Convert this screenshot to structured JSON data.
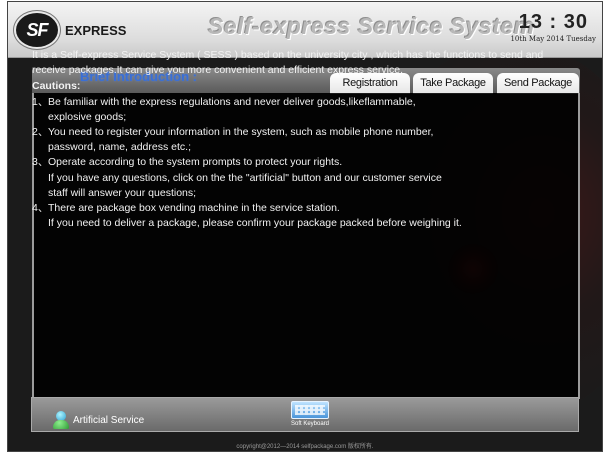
{
  "header": {
    "logo_badge": "SF",
    "logo_text": "EXPRESS",
    "system_title": "Self-express Service System",
    "time": "13 : 30",
    "date": "10th May 2014  Tuesday"
  },
  "brief": {
    "title": "Brief Introduction :"
  },
  "tabs": [
    {
      "label": "Registration"
    },
    {
      "label": "Take Package"
    },
    {
      "label": "Send Package"
    }
  ],
  "content": {
    "intro": "It is a Self-express Service System ( SESS ) based on the university city , which has the functions to send and receive packages.It can give you more convenient and efficient express service.",
    "cautions_title": "Cautions:",
    "cautions": [
      {
        "num": "1、",
        "lines": [
          "Be familiar with the express regulations and never deliver goods,likeflammable,",
          "explosive goods;"
        ]
      },
      {
        "num": "2、",
        "lines": [
          "You need to register your information in the system, such as mobile phone number,",
          "password, name, address etc.;"
        ]
      },
      {
        "num": "3、",
        "lines": [
          "Operate according to the system prompts to protect your rights.",
          "If you have any questions, click on the the \"artificial\" button and our customer service",
          "staff will answer your questions;"
        ]
      },
      {
        "num": "4、",
        "lines": [
          "There are package box vending machine in the service station.",
          "If you need to deliver a package, please confirm your package packed before weighing it."
        ]
      }
    ]
  },
  "bottom": {
    "service_label": "Artificial Service",
    "keyboard_label": "Soft Keyboard"
  },
  "footer": {
    "copyright": "copyright@2012—2014 selfpackage.com 版权所有."
  },
  "colors": {
    "accent_blue": "#3a6fd6",
    "panel_dark": "#1b1b1b"
  }
}
